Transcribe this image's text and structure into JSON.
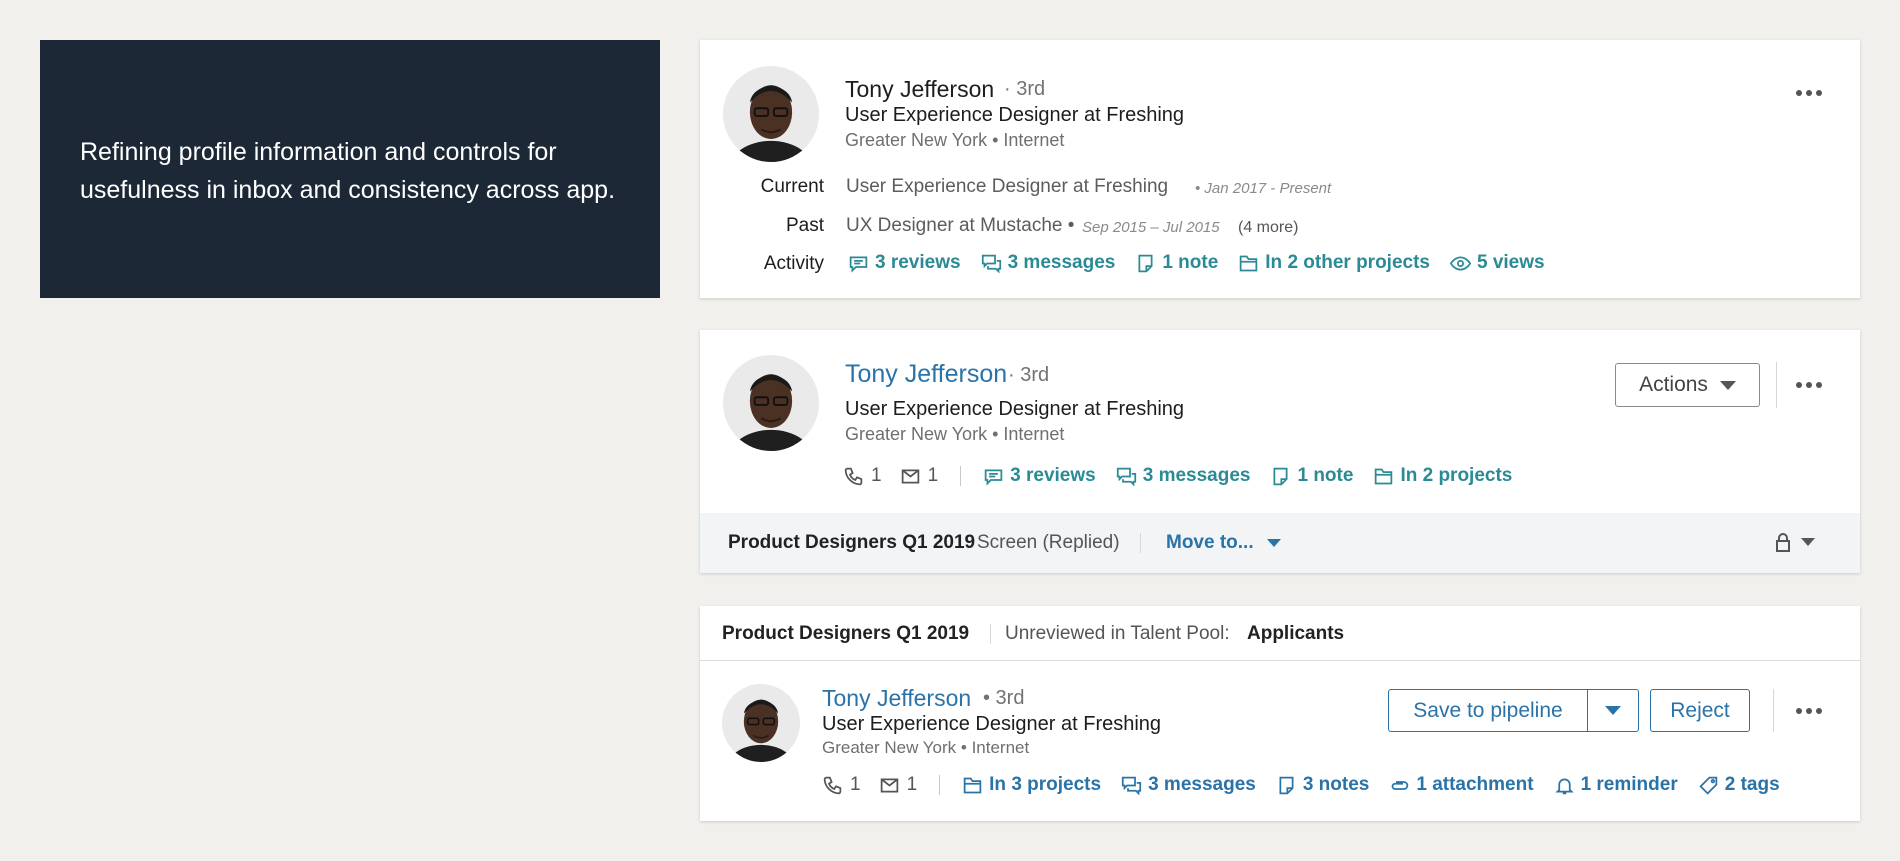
{
  "intro": {
    "text": "Refining profile information and controls for usefulness in inbox and consistency across app."
  },
  "card1": {
    "name": "Tony Jefferson",
    "degree": "· 3rd",
    "headline": "User Experience Designer at Freshing",
    "location": "Greater New York • Internet",
    "current_label": "Current",
    "current_text": "User Experience Designer at Freshing",
    "current_date": "• Jan 2017 - Present",
    "past_label": "Past",
    "past_text": "UX Designer at Mustache •",
    "past_date": "Sep 2015 – Jul 2015",
    "past_more": "(4 more)",
    "activity_label": "Activity",
    "activity": [
      {
        "icon": "review-icon",
        "label": "3 reviews"
      },
      {
        "icon": "messages-icon",
        "label": "3 messages"
      },
      {
        "icon": "note-icon",
        "label": "1 note"
      },
      {
        "icon": "folder-icon",
        "label": "In 2 other projects"
      },
      {
        "icon": "eye-icon",
        "label": "5 views"
      }
    ]
  },
  "card2": {
    "name": "Tony Jefferson",
    "degree": "· 3rd",
    "headline": "User Experience Designer at Freshing",
    "location": "Greater New York • Internet",
    "phone_count": "1",
    "mail_count": "1",
    "activity": [
      {
        "icon": "review-icon",
        "label": "3 reviews"
      },
      {
        "icon": "messages-icon",
        "label": "3 messages"
      },
      {
        "icon": "note-icon",
        "label": "1 note"
      },
      {
        "icon": "folder-icon",
        "label": "In 2 projects"
      }
    ],
    "actions_label": "Actions",
    "footer_project": "Product Designers Q1 2019",
    "footer_stage": "Screen (Replied)",
    "footer_move": "Move to..."
  },
  "card3": {
    "project": "Product Designers Q1 2019",
    "pool_text": "Unreviewed in Talent Pool:",
    "pool_name": "Applicants",
    "name": "Tony Jefferson",
    "degree": "• 3rd",
    "headline": "User Experience Designer at Freshing",
    "location": "Greater New York • Internet",
    "phone_count": "1",
    "mail_count": "1",
    "activity": [
      {
        "icon": "folder-icon",
        "label": "In 3 projects"
      },
      {
        "icon": "messages-icon",
        "label": "3 messages"
      },
      {
        "icon": "note-icon",
        "label": "3 notes"
      },
      {
        "icon": "attachment-icon",
        "label": "1 attachment"
      },
      {
        "icon": "bell-icon",
        "label": "1 reminder"
      },
      {
        "icon": "tag-icon",
        "label": "2 tags"
      }
    ],
    "save_label": "Save to pipeline",
    "reject_label": "Reject"
  },
  "colors": {
    "teal": "#2a8a95",
    "blue": "#2a73a8",
    "dark_panel": "#1c2836"
  }
}
